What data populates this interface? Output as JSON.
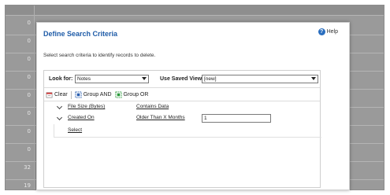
{
  "background": {
    "row_numbers": [
      "0",
      "0",
      "0",
      "0",
      "0",
      "0",
      "0",
      "0",
      "32",
      "19"
    ]
  },
  "dialog": {
    "title": "Define Search Criteria",
    "help_label": "Help",
    "instructions": "Select search criteria to identify records to delete.",
    "look_for_label": "Look for:",
    "look_for_value": "Notes",
    "saved_view_label": "Use Saved View:",
    "saved_view_value": "[new]",
    "toolbar": {
      "clear_label": "Clear",
      "group_and_label": "Group AND",
      "group_or_label": "Group OR"
    },
    "criteria": [
      {
        "field": "File Size (Bytes)",
        "operator": "Contains Data",
        "value": ""
      },
      {
        "field": "Created On",
        "operator": "Older Than X Months",
        "value": "1"
      }
    ],
    "select_link": "Select"
  },
  "colors": {
    "title": "#1f5ca8",
    "help_icon": "#2a6ebf",
    "background_grid": "#9a9a9a"
  }
}
